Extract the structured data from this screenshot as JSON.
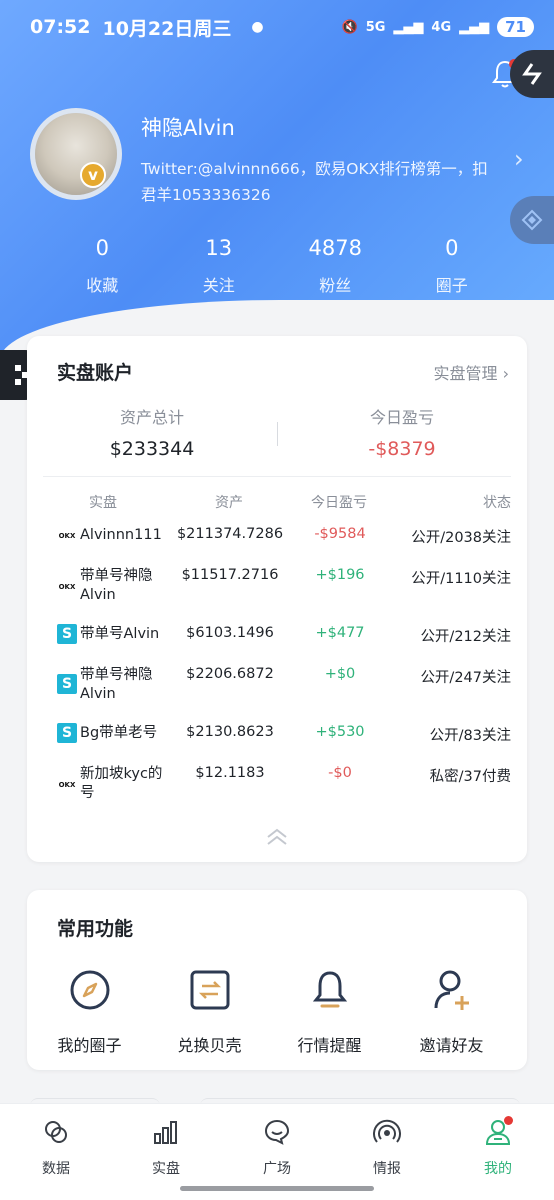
{
  "status_bar": {
    "time": "07:52",
    "date": "10月22日周三",
    "battery": "71",
    "net_5g": "5G",
    "net_4g": "4G"
  },
  "profile": {
    "username": "神隐Alvin",
    "bio": "Twitter:@alvinnn666，欧易OKX排行榜第一，扣君羊1053336326",
    "badge": "v",
    "stats": [
      {
        "num": "0",
        "label": "收藏"
      },
      {
        "num": "13",
        "label": "关注"
      },
      {
        "num": "4878",
        "label": "粉丝"
      },
      {
        "num": "0",
        "label": "圈子"
      }
    ]
  },
  "accounts": {
    "title": "实盘账户",
    "manage_label": "实盘管理",
    "total_assets_label": "资产总计",
    "total_assets": "$233344",
    "today_pnl_label": "今日盈亏",
    "today_pnl": "-$8379",
    "columns": [
      "实盘",
      "资产",
      "今日盈亏",
      "状态"
    ],
    "rows": [
      {
        "exchange": "okx",
        "name": "Alvinnn111",
        "asset": "$211374.7286",
        "pnl": "-$9584",
        "pnl_sign": "neg",
        "status": "公开/2038关注"
      },
      {
        "exchange": "okx",
        "name": "带单号神隐Alvin",
        "asset": "$11517.2716",
        "pnl": "+$196",
        "pnl_sign": "pos",
        "status": "公开/1110关注"
      },
      {
        "exchange": "bitget",
        "name": "带单号Alvin",
        "asset": "$6103.1496",
        "pnl": "+$477",
        "pnl_sign": "pos",
        "status": "公开/212关注"
      },
      {
        "exchange": "bitget",
        "name": "带单号神隐Alvin",
        "asset": "$2206.6872",
        "pnl": "+$0",
        "pnl_sign": "pos",
        "status": "公开/247关注"
      },
      {
        "exchange": "bitget",
        "name": "Bg带单老号",
        "asset": "$2130.8623",
        "pnl": "+$530",
        "pnl_sign": "pos",
        "status": "公开/83关注"
      },
      {
        "exchange": "okx",
        "name": "新加坡kyc的号",
        "asset": "$12.1183",
        "pnl": "-$0",
        "pnl_sign": "neg",
        "status": "私密/37付费"
      }
    ],
    "exchange_logo_text": "OKX"
  },
  "features": {
    "title": "常用功能",
    "items": [
      {
        "label": "我的圈子",
        "icon": "compass-icon"
      },
      {
        "label": "兑换贝壳",
        "icon": "exchange-icon"
      },
      {
        "label": "行情提醒",
        "icon": "bell-icon"
      },
      {
        "label": "邀请好友",
        "icon": "add-user-icon"
      }
    ]
  },
  "tabbar": {
    "items": [
      {
        "label": "数据",
        "icon": "data-icon"
      },
      {
        "label": "实盘",
        "icon": "bar-chart-icon"
      },
      {
        "label": "广场",
        "icon": "chat-icon"
      },
      {
        "label": "情报",
        "icon": "broadcast-icon"
      },
      {
        "label": "我的",
        "icon": "user-icon",
        "active": true
      }
    ]
  },
  "colors": {
    "accent_blue": "#4e8df6",
    "positive": "#2fb27a",
    "negative": "#e05a5a",
    "feature_gold": "#d8a25a",
    "feature_navy": "#2d3a52"
  }
}
